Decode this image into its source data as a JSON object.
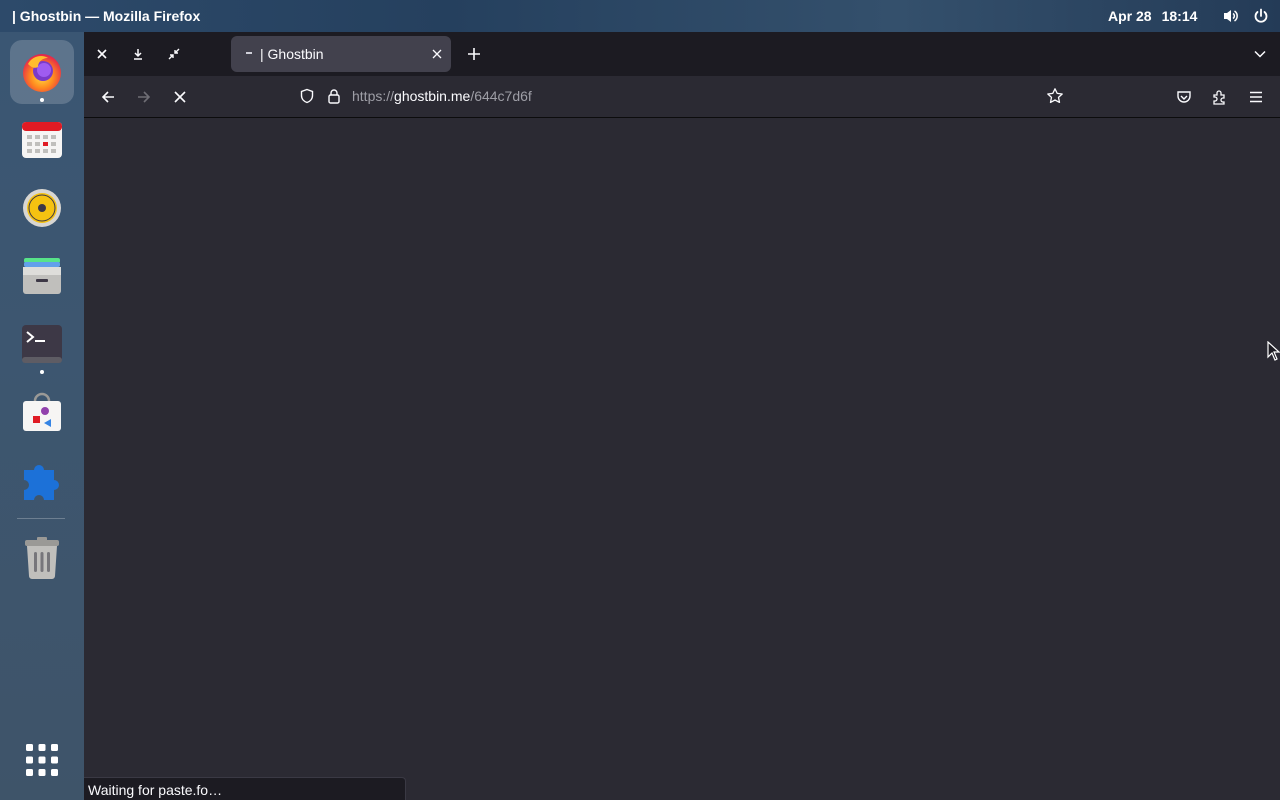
{
  "system_bar": {
    "window_title": "| Ghostbin — Mozilla Firefox",
    "date": "Apr 28",
    "time": "18:14",
    "icons": [
      "volume-icon",
      "power-icon"
    ]
  },
  "dock": {
    "apps": [
      {
        "name": "firefox",
        "running": true,
        "active": true
      },
      {
        "name": "calendar",
        "running": false
      },
      {
        "name": "rhythmbox",
        "running": false
      },
      {
        "name": "files",
        "running": false
      },
      {
        "name": "terminal",
        "running": true
      },
      {
        "name": "software",
        "running": false
      },
      {
        "name": "extensions",
        "running": false
      },
      {
        "name": "trash",
        "running": false
      }
    ],
    "show_apps_icon": "app-grid-icon"
  },
  "browser": {
    "tabbar_buttons": [
      "close-icon",
      "download-icon",
      "restore-icon"
    ],
    "tab": {
      "title": "| Ghostbin",
      "loading": true
    },
    "new_tab_icon": "plus-icon",
    "list_tabs_icon": "chevron-down-icon",
    "nav": {
      "back_icon": "arrow-left-icon",
      "forward_icon": "arrow-right-icon",
      "stop_icon": "stop-icon"
    },
    "url": {
      "prefix": "https://",
      "domain": "ghostbin.me",
      "path": "/644c7d6f"
    },
    "toolbar_icons": [
      "bookmark-star-icon",
      "pocket-icon",
      "extensions-icon",
      "menu-icon"
    ],
    "status_text": "Waiting for paste.fo…"
  },
  "colors": {
    "content_bg": "#2b2a33",
    "tabbar_bg": "#1c1b22",
    "tab_active_bg": "#42414d",
    "text": "#fbfbfe",
    "url_dim": "#9e9ea6"
  }
}
